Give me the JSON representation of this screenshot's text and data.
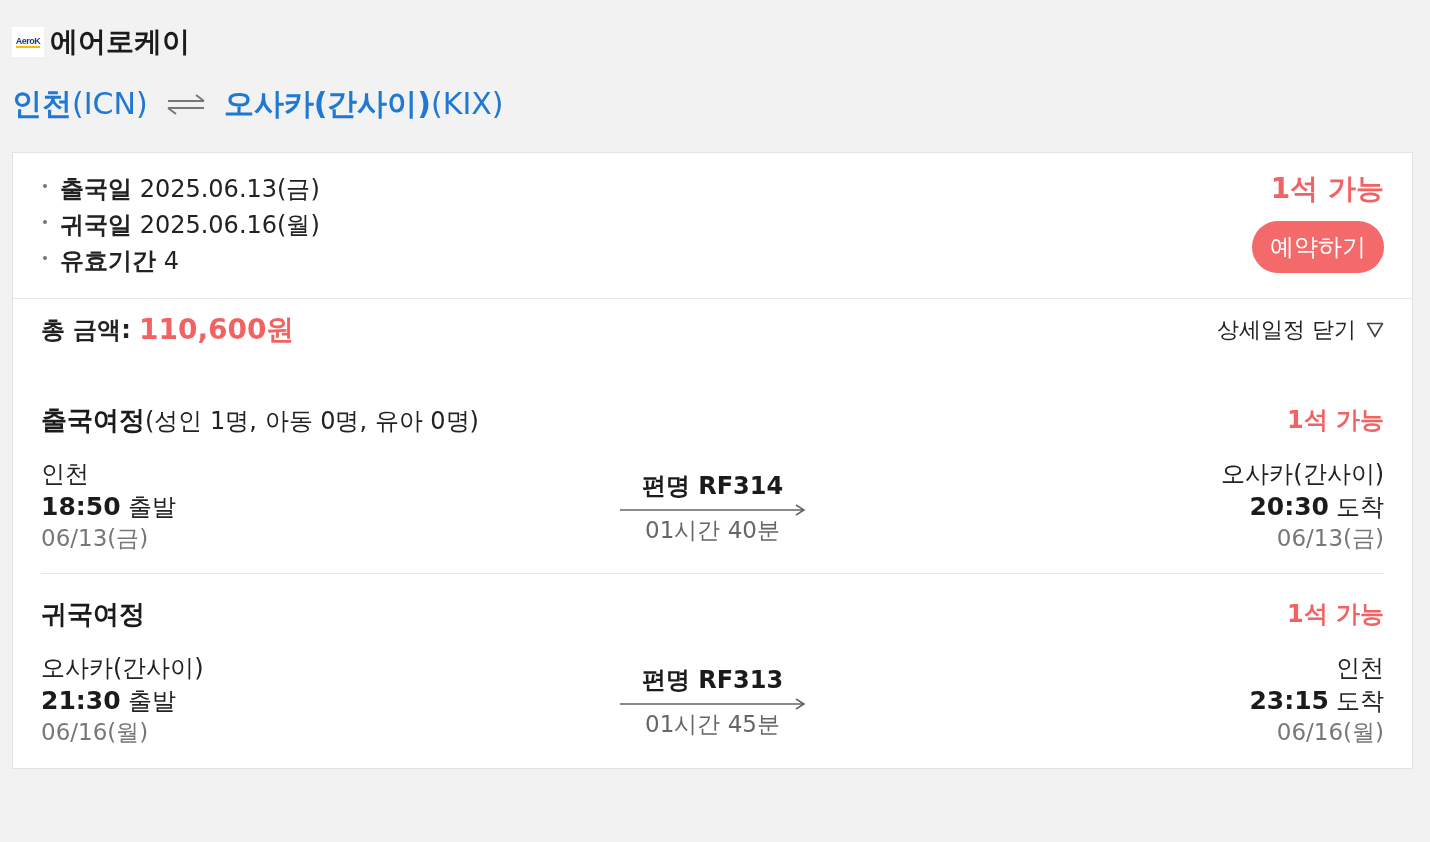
{
  "airline": {
    "logo_text": "AeroK",
    "name": "에어로케이"
  },
  "route": {
    "origin": {
      "city": "인천",
      "code": "(ICN)"
    },
    "destination": {
      "city": "오사카(간사이)",
      "code": "(KIX)"
    }
  },
  "summary": {
    "details": [
      {
        "label": "출국일",
        "value": "2025.06.13(금)"
      },
      {
        "label": "귀국일",
        "value": "2025.06.16(월)"
      },
      {
        "label": "유효기간",
        "value": "4"
      }
    ],
    "availability": "1석 가능",
    "book_button": "예약하기"
  },
  "total": {
    "label": "총 금액:",
    "amount": "110,600원"
  },
  "details_toggle": {
    "label": "상세일정 닫기",
    "expanded": true
  },
  "journeys": [
    {
      "title": "출국여정",
      "passengers": "(성인 1명, 아동 0명, 유아 0명)",
      "availability": "1석 가능",
      "departure": {
        "place": "인천",
        "time": "18:50",
        "action": "출발",
        "date": "06/13(금)"
      },
      "flight": "편명 RF314",
      "duration": "01시간 40분",
      "arrival": {
        "place": "오사카(간사이)",
        "time": "20:30",
        "action": "도착",
        "date": "06/13(금)"
      }
    },
    {
      "title": "귀국여정",
      "availability": "1석 가능",
      "departure": {
        "place": "오사카(간사이)",
        "time": "21:30",
        "action": "출발",
        "date": "06/16(월)"
      },
      "flight": "편명 RF313",
      "duration": "01시간 45분",
      "arrival": {
        "place": "인천",
        "time": "23:15",
        "action": "도착",
        "date": "06/16(월)"
      }
    }
  ]
}
